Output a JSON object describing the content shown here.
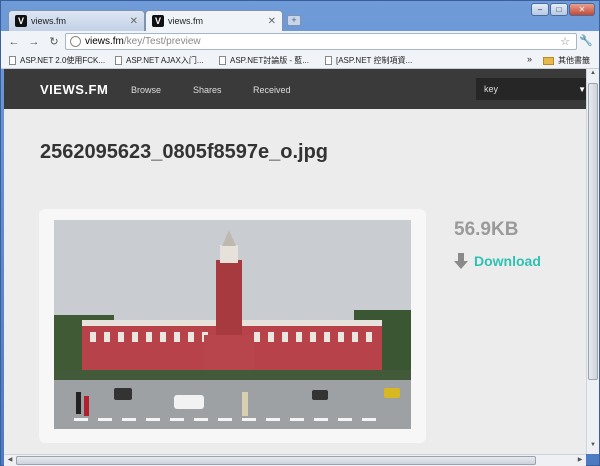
{
  "browser": {
    "tabs": [
      {
        "label": "views.fm",
        "favicon": "V",
        "active": false
      },
      {
        "label": "views.fm",
        "favicon": "V",
        "active": true
      }
    ],
    "new_tab_label": "+",
    "window_buttons": {
      "minimize": "–",
      "maximize": "□",
      "close": "✕"
    },
    "nav": {
      "back": "←",
      "forward": "→",
      "reload": "↻"
    },
    "url": {
      "host": "views.fm",
      "path": "/key/Test/preview"
    },
    "bookmarks": [
      "ASP.NET 2.0使用FCK...",
      "ASP.NET AJAX入门...",
      "ASP.NET討論版 - 藍...",
      "[ASP.NET 控制項資..."
    ],
    "bookmarks_more": "»",
    "other_bookmarks": "其他書籤",
    "icons": {
      "star": "star-icon",
      "wrench": "wrench-icon",
      "globe": "globe-icon",
      "folder": "folder-icon"
    }
  },
  "site": {
    "logo": "VIEWS.FM",
    "nav_links": [
      "Browse",
      "Shares",
      "Received"
    ],
    "search_value": "key",
    "search_arrow": "▼"
  },
  "file": {
    "name": "2562095623_0805f8597e_o.jpg",
    "size": "56.9KB",
    "download_label": "Download",
    "accent_color": "#2fc1b4"
  }
}
